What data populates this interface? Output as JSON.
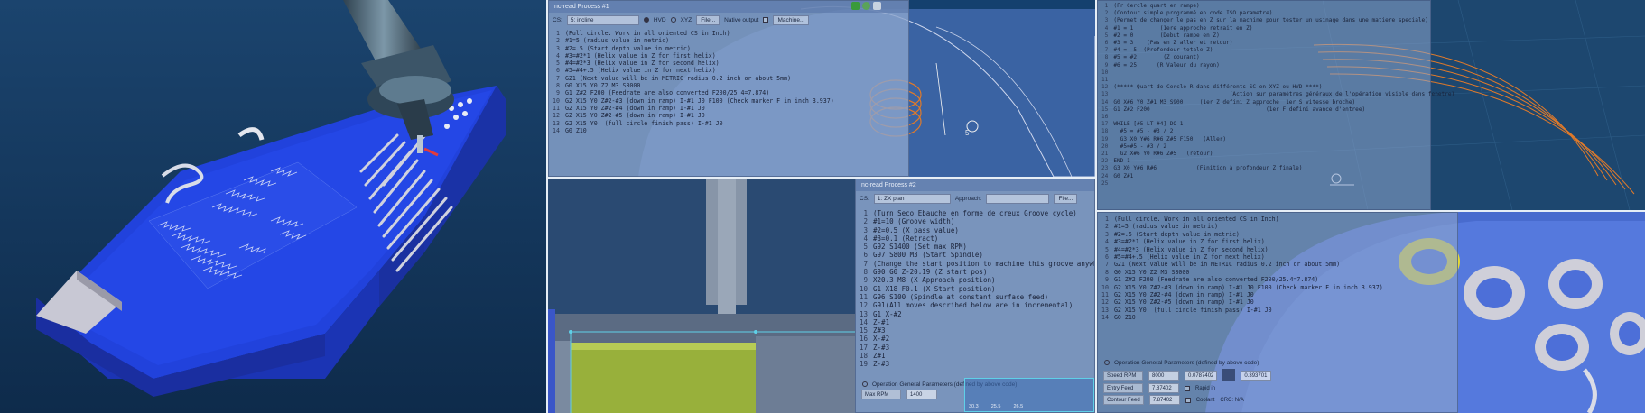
{
  "colors": {
    "viewport_bg": "#0b2a4a",
    "part_blue": "#1f3fd8",
    "part_side": "#1d35a8",
    "toolpath_orange": "#e07a2a",
    "pocket_yellow": "#e7d930",
    "stock_green": "#9ab03a",
    "window_tint": "#8ca5cd"
  },
  "icons": [
    "tool-holder-icon",
    "gear-icon",
    "check-icon",
    "refresh-icon",
    "close-icon",
    "info-icon"
  ],
  "panel2": {
    "window_title": "nc-read Process #1",
    "cs_label": "CS:",
    "cs_value": "5: incline",
    "radio_hvd": "HVD",
    "radio_xyz": "XYZ",
    "file_btn": "File...",
    "native_output": "Native output",
    "machine_btn": "Machine...",
    "line_numbers": [
      "1",
      "2",
      "3",
      "4",
      "5",
      "6",
      "7",
      "8",
      "9",
      "10",
      "11",
      "12",
      "13",
      "14"
    ],
    "code_lines": [
      "(Full circle. Work in all oriented CS in Inch)",
      "#1=5 (radius value in metric)",
      "#2=.5 (Start depth value in metric)",
      "#3=#2*1 (Helix value in Z for first helix)",
      "#4=#2*3 (Helix value in Z for second helix)",
      "#5=#4+.5 (Helix value in Z for next helix)",
      "G21 (Next value will be in METRIC radius 0.2 inch or about 5mm)",
      "G0 X15 Y0 Z2 M3 S8000",
      "G1 Z#2 F200 (Feedrate are also converted F200/25.4=7.874)",
      "G2 X15 Y0 Z#2-#3 (down in ramp) I-#1 J0 F100 (Check marker F in inch 3.937)",
      "G2 X15 Y0 Z#2-#4 (down in ramp) I-#1 J0",
      "G2 X15 Y0 Z#2-#5 (down in ramp) I-#1 J0",
      "G2 X15 Y0  (full circle finish pass) I-#1 J0",
      "G0 Z10"
    ]
  },
  "panel3": {
    "window_title": "nc-read Process #2",
    "cs_label": "CS:",
    "cs_value": "1: ZX plan",
    "approach_label": "Approach:",
    "file_btn": "File...",
    "line_numbers": [
      "1",
      "2",
      "3",
      "4",
      "5",
      "6",
      "7",
      "8",
      "9",
      "10",
      "11",
      "12",
      "13",
      "14",
      "15",
      "16",
      "17",
      "18",
      "19"
    ],
    "code_lines": [
      "(Turn Seco Ebauche en forme de creux Groove cycle)",
      "#1=10 (Groove width)",
      "#2=0.5 (X pass value)",
      "#3=0.1 (Retract)",
      "G92 S1400 (Set max RPM)",
      "G97 S800 M3 (Start Spindle)",
      "(Change the start position to machine this groove anywhere)",
      "G90 G0 Z-20.19 (Z start pos)",
      "X20.3 M8 (X Approach position)",
      "G1 X18 F0.1 (X Start position)",
      "G96 S100 (Spindle at constant surface feed)",
      "G91(All moves described below are in incremental)",
      "G1 X-#2",
      "Z-#1",
      "Z#3",
      "X-#2",
      "Z-#3",
      "Z#1",
      "Z-#3"
    ],
    "params_title": "Operation General Parameters (defined by above code)",
    "max_rpm_label": "Max RPM",
    "max_rpm_value": "1400",
    "mini_values": [
      "30.3",
      "25.5",
      "26.5"
    ]
  },
  "panel4": {
    "line_numbers": [
      "1",
      "2",
      "3",
      "4",
      "5",
      "6",
      "7",
      "8",
      "9",
      "10",
      "11",
      "12",
      "13",
      "14",
      "15",
      "16",
      "17",
      "18",
      "19",
      "20",
      "21",
      "22",
      "23",
      "24",
      "25"
    ],
    "code_lines": [
      "(Fr Cercle quart en rampe)",
      "(Contour simple programmé en code ISO parametre)",
      "(Permet de changer le pas en Z sur la machine pour tester un usinage dans une matiere speciale)",
      "#1 = 1        (1ere approche retrait en Z)",
      "#2 = 0        (Debut rampe en Z)",
      "#3 = 3    (Pas en Z aller et retour)",
      "#4 = -5  (Profondeur totale Z)",
      "#5 = #2        (Z courant)",
      "#6 = 25      (R Valeur du rayon)",
      "",
      "",
      "(***** Quart de Cercle R dans différents SC en XYZ ou HVD ****)",
      "                                   (Action sur paramètres généraux de l'opération visible dans fenetre)",
      "G0 X#6 Y0 Z#1 M3 S900     (1er Z defini Z approche  1er S vitesse broche)",
      "G1 Z#2 F200                                   (1er F defini avance d'entree)",
      "",
      "WHILE [#5 LT #4] DO 1",
      "  #5 = #5 - #3 / 2",
      "  G3 X0 Y#6 R#6 Z#5 F150   (Aller)",
      "  #5=#5 - #3 / 2",
      "  G2 X#6 Y0 R#6 Z#5   (retour)",
      "END 1",
      "G3 X0 Y#6 R#6            (Finition à profondeur Z finale)",
      "G0 Z#1",
      ""
    ]
  },
  "panel5": {
    "line_numbers": [
      "1",
      "2",
      "3",
      "4",
      "5",
      "6",
      "7",
      "8",
      "9",
      "10",
      "11",
      "12",
      "13",
      "14"
    ],
    "code_lines": [
      "(Full circle. Work in all oriented CS in Inch)",
      "#1=5 (radius value in metric)",
      "#2=.5 (Start depth value in metric)",
      "#3=#2*1 (Helix value in Z for first helix)",
      "#4=#2*3 (Helix value in Z for second helix)",
      "#5=#4+.5 (Helix value in Z for next helix)",
      "G21 (Next value will be in METRIC radius 0.2 inch or about 5mm)",
      "G0 X15 Y0 Z2 M3 S8000",
      "G1 Z#2 F200 (Feedrate are also converted F200/25.4=7.874)",
      "G2 X15 Y0 Z#2-#3 (down in ramp) I-#1 J0 F100 (Check marker F in inch 3.937)",
      "G2 X15 Y0 Z#2-#4 (down in ramp) I-#1 J0",
      "G2 X15 Y0 Z#2-#5 (down in ramp) I-#1 J0",
      "G2 X15 Y0  (full circle finish pass) I-#1 J0",
      "G0 Z10"
    ],
    "params_title": "Operation General Parameters (defined by above code)",
    "speed_label": "Speed RPM",
    "speed_value": "8000",
    "entry_label": "Entry Feed",
    "entry_value": "7.87402",
    "contour_label": "Contour Feed",
    "contour_value": "7.87402",
    "mid_value": "0.0787402",
    "right_value": "0.393701",
    "rapid_label": "Rapid in",
    "coolant_label": "Coolant",
    "crc_label": "CRC: N/A"
  }
}
